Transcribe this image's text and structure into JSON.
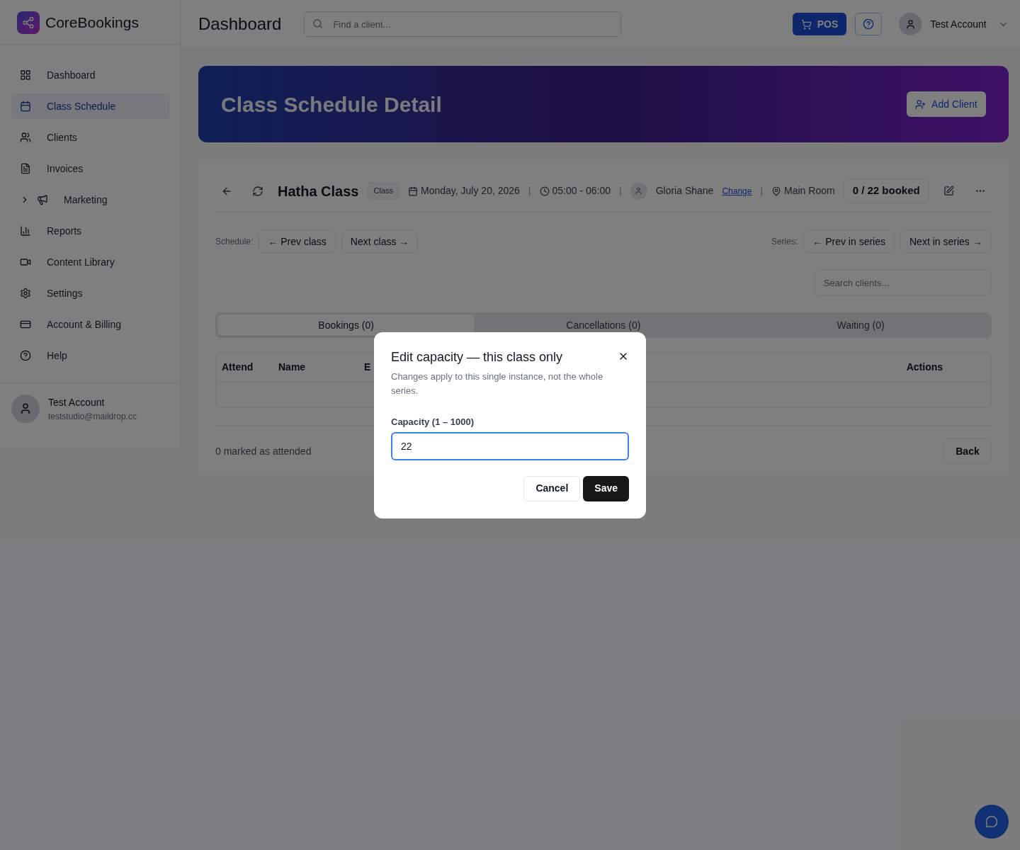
{
  "brand": {
    "name": "CoreBookings"
  },
  "sidebar": {
    "items": [
      {
        "label": "Dashboard",
        "selected": false
      },
      {
        "label": "Class Schedule",
        "selected": true
      },
      {
        "label": "Clients",
        "selected": false
      },
      {
        "label": "Invoices",
        "selected": false
      },
      {
        "label": "Marketing",
        "selected": false,
        "expanded": false
      },
      {
        "label": "Reports",
        "selected": false
      },
      {
        "label": "Content Library",
        "selected": false
      },
      {
        "label": "Settings",
        "selected": false
      },
      {
        "label": "Account & Billing",
        "selected": false
      },
      {
        "label": "Help",
        "selected": false
      }
    ],
    "user": {
      "name": "Test Account",
      "email": "teststudio@maildrop.cc"
    }
  },
  "header": {
    "title": "Dashboard",
    "search": {
      "placeholder": "Find a client..."
    },
    "pos_button": "POS",
    "account": "Test Account"
  },
  "banner": {
    "title": "Class Schedule Detail",
    "add_client": "Add Client"
  },
  "class": {
    "name": "Hatha Class",
    "badge": "Class",
    "date": "Monday, July 20, 2026",
    "time": "05:00 - 06:00",
    "instructor": "Gloria Shane",
    "change_link": "Change",
    "room": "Main Room",
    "separators": [
      "|",
      "|",
      "|"
    ],
    "booked": "0 / 22 booked"
  },
  "navigation": {
    "schedule_label": "Schedule:",
    "prev_class": "← Prev class",
    "next_class": "Next class →",
    "series_label": "Series:",
    "prev_series": "← Prev in series",
    "next_series": "Next in series →"
  },
  "client_search": {
    "placeholder": "Search clients..."
  },
  "tabs": [
    {
      "label": "Bookings (0)",
      "selected": true
    },
    {
      "label": "Cancellations (0)",
      "selected": false
    },
    {
      "label": "Waiting (0)",
      "selected": false
    }
  ],
  "table": {
    "columns": [
      "Attend",
      "Name",
      "E",
      "Actions"
    ]
  },
  "footer": {
    "attended": "0 marked as attended",
    "back": "Back"
  },
  "dialog": {
    "title": "Edit capacity — this class only",
    "description": "Changes apply to this single instance, not the whole series.",
    "field_label": "Capacity (1 – 1000)",
    "value": "22",
    "cancel": "Cancel",
    "save": "Save"
  }
}
